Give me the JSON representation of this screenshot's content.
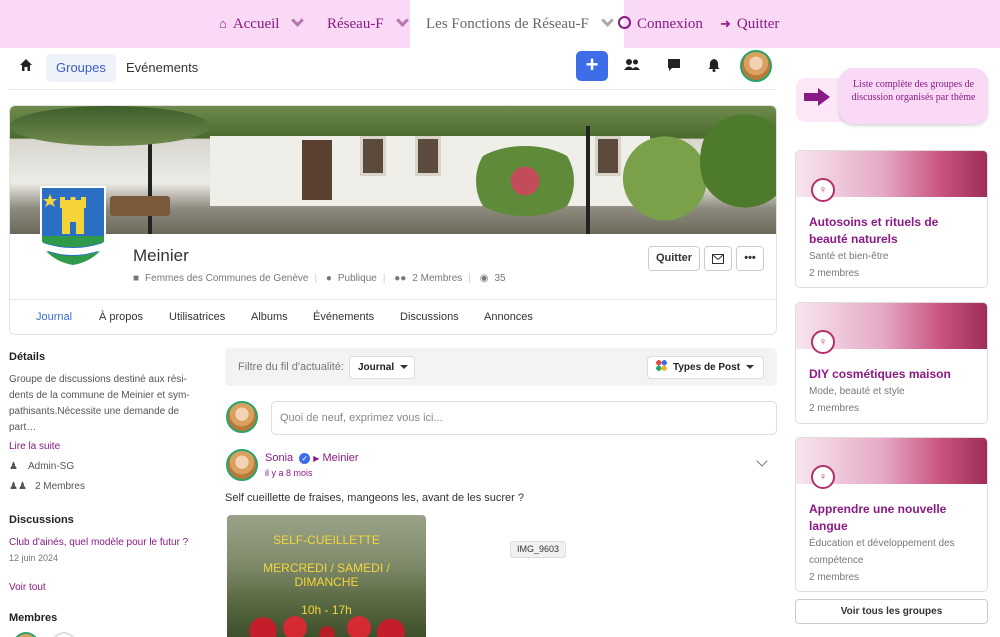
{
  "topmenu": {
    "items": [
      "Accueil",
      "Réseau-F",
      "Les Fonctions de Réseau-F",
      "Connexion",
      "Quitter"
    ]
  },
  "nav": {
    "tabs": [
      "Groupes",
      "Evénements"
    ],
    "plus": "+"
  },
  "group": {
    "title": "Meinier",
    "category": "Femmes des Communes de Genève",
    "privacy": "Publique",
    "members": "2 Membres",
    "views": "35",
    "buttons": {
      "quit": "Quitter"
    },
    "tabs": [
      "Journal",
      "À propos",
      "Utilisatrices",
      "Albums",
      "Événements",
      "Discussions",
      "Annonces"
    ]
  },
  "details": {
    "heading": "Détails",
    "description": [
      "Groupe de discussions destiné aux rési-",
      "dents de la commune de Meinier et sym-",
      "pathisants.Nécessite une demande de",
      "part…"
    ],
    "read_more": "Lire la suite",
    "admin": "Admin-SG",
    "members": "2 Membres"
  },
  "discussions": {
    "heading": "Discussions",
    "item_title": "Club d'ainés, quel modèle pour le futur ?",
    "item_date": "12 juin 2024",
    "see_all": "Voir tout"
  },
  "members_section": {
    "heading": "Membres"
  },
  "feed": {
    "filter_label": "Filtre du fil d'actualité:",
    "filter_value": "Journal",
    "post_types": "Types de Post",
    "compose_placeholder": "Quoi de neuf, exprimez vous ici...",
    "post": {
      "author": "Sonia",
      "group": "Meinier",
      "time": "il y a 8 mois",
      "text": "Self cueillette de fraises, mangeons les, avant de les sucrer ?",
      "image_lines": [
        "SELF-CUEILLETTE",
        "MERCREDI / SAMEDI /",
        "DIMANCHE",
        "10h - 17h"
      ],
      "tooltip": "IMG_9603"
    }
  },
  "sidebar": {
    "banner": "Liste complète des groupes de discussion organisés par thème",
    "groups": [
      {
        "title": "Autosoins et rituels de beauté naturels",
        "category": "Santé et bien-être",
        "members": "2 membres"
      },
      {
        "title": "DIY cosmétiques maison",
        "category": "Mode, beauté et style",
        "members": "2 membres"
      },
      {
        "title": "Apprendre une nouvelle langue",
        "category": "Éducation et développement des compétence",
        "members": "2 membres"
      }
    ],
    "see_all": "Voir tous les groupes"
  },
  "colors": {
    "accent": "#8a1a86",
    "menu_bg": "#f9d9f5",
    "primary": "#3d6ee8"
  }
}
